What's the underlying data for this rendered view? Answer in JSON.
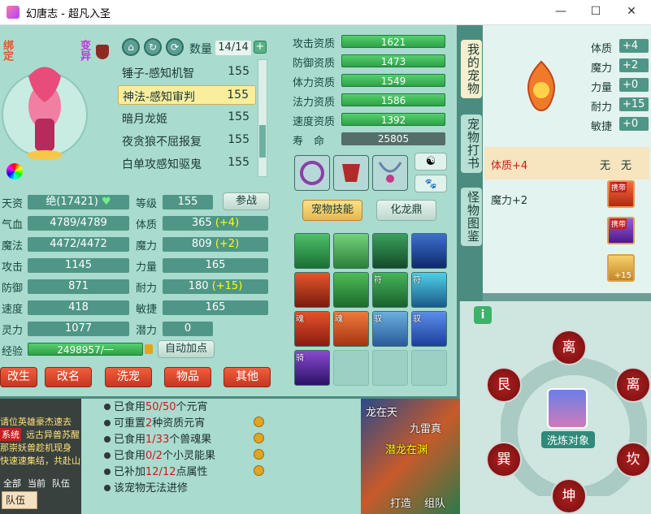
{
  "window": {
    "title": "幻唐志 - 超凡入圣"
  },
  "pet": {
    "tags": [
      "绑定",
      "变异"
    ],
    "count_label": "数量",
    "count": "14/14",
    "list": [
      {
        "name": "锤子-感知机智",
        "level": "155"
      },
      {
        "name": "神法-感知审判",
        "level": "155"
      },
      {
        "name": "暗月龙姬",
        "level": "155"
      },
      {
        "name": "夜贪狼不屈报复",
        "level": "155"
      },
      {
        "name": "白单攻感知驱鬼",
        "level": "155"
      }
    ],
    "selected_index": 1
  },
  "stats_left": [
    {
      "label": "天资",
      "value": "绝(17421)"
    },
    {
      "label": "气血",
      "value": "4789/4789"
    },
    {
      "label": "魔法",
      "value": "4472/4472"
    },
    {
      "label": "攻击",
      "value": "1145"
    },
    {
      "label": "防御",
      "value": "871"
    },
    {
      "label": "速度",
      "value": "418"
    },
    {
      "label": "灵力",
      "value": "1077"
    }
  ],
  "stats_mid": [
    {
      "label": "等级",
      "value": "155",
      "bonus": ""
    },
    {
      "label": "体质",
      "value": "365",
      "bonus": "(+4)"
    },
    {
      "label": "魔力",
      "value": "809",
      "bonus": "(+2)"
    },
    {
      "label": "力量",
      "value": "165",
      "bonus": ""
    },
    {
      "label": "耐力",
      "value": "180",
      "bonus": "(+15)"
    },
    {
      "label": "敏捷",
      "value": "165",
      "bonus": ""
    },
    {
      "label": "潜力",
      "value": "0",
      "bonus": ""
    }
  ],
  "exp": {
    "label": "经验",
    "value": "2498957/一"
  },
  "buttons": {
    "fight": "参战",
    "auto_points": "自动加点",
    "pet_skills": "宠物技能",
    "dragon": "化龙鼎"
  },
  "bottom_buttons": [
    "改生",
    "改名",
    "洗宠",
    "物品",
    "其他"
  ],
  "aptitude": [
    {
      "label": "攻击资质",
      "value": "1621"
    },
    {
      "label": "防御资质",
      "value": "1473"
    },
    {
      "label": "体力资质",
      "value": "1549"
    },
    {
      "label": "法力资质",
      "value": "1586"
    },
    {
      "label": "速度资质",
      "value": "1392"
    },
    {
      "label": "寿　命",
      "value": "25805"
    }
  ],
  "skill_tags": [
    "符",
    "符",
    "魂",
    "魂",
    "驭",
    "驭",
    "骑"
  ],
  "side_tabs": [
    "我的宠物",
    "宠物打书",
    "怪物图鉴"
  ],
  "right_stats": [
    {
      "label": "体质",
      "value": "+4"
    },
    {
      "label": "魔力",
      "value": "+2"
    },
    {
      "label": "力量",
      "value": "+0"
    },
    {
      "label": "耐力",
      "value": "+15"
    },
    {
      "label": "敏捷",
      "value": "+0"
    }
  ],
  "right_rows": [
    {
      "text": "体质+4",
      "extra": "无　无"
    },
    {
      "text": "魔力+2",
      "extra": ""
    }
  ],
  "carry_label": "携带",
  "plus15": "+15",
  "info_lines": [
    {
      "pre": "已食用",
      "red": "50/50",
      "post": "个元宵"
    },
    {
      "pre": "可重置",
      "red": "2",
      "post": "种资质元宵"
    },
    {
      "pre": "已食用",
      "red": "1/33",
      "post": "个兽魂果"
    },
    {
      "pre": "已食用",
      "red": "0/2",
      "post": "个小灵能果"
    },
    {
      "pre": "已补加",
      "red": "12/12",
      "post": "点属性"
    },
    {
      "pre": "该宠物无法进修",
      "red": "",
      "post": ""
    }
  ],
  "trigrams": [
    "离",
    "艮",
    "离",
    "巽",
    "坎",
    "坤"
  ],
  "wash_target": "洗炼对象",
  "chat": {
    "lines": [
      "请位英雄豪杰速去",
      "系统",
      "远古异兽苏醒",
      "那崇妖兽趁机现身",
      "快速速集结，共赴山"
    ],
    "tabs": [
      "全部",
      "当前",
      "队伍"
    ],
    "input_tab": "队伍"
  },
  "map_text": [
    "龙在天",
    "九雷真",
    "潜龙在渊",
    "打造",
    "组队"
  ]
}
